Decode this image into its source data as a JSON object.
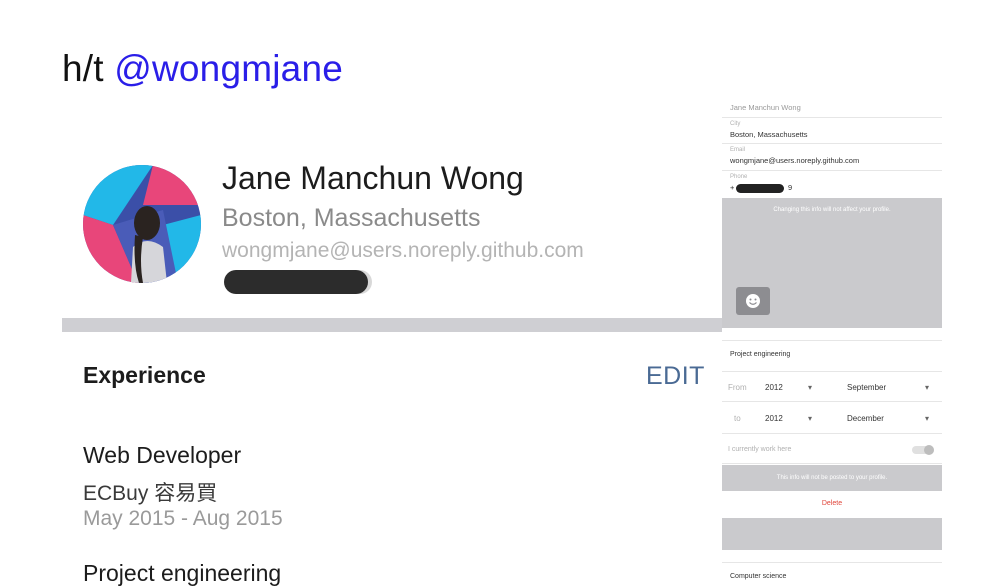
{
  "header": {
    "prefix": "h/t ",
    "handle": "@wongmjane"
  },
  "profile": {
    "name": "Jane Manchun Wong",
    "city": "Boston, Massachusetts",
    "email": "wongmjane@users.noreply.github.com"
  },
  "experience": {
    "title": "Experience",
    "edit_label": "EDIT",
    "jobs": [
      {
        "title": "Web Developer",
        "company": "ECBuy 容易買",
        "dates": "May 2015 - Aug 2015"
      },
      {
        "title": "Project engineering"
      }
    ]
  },
  "phone": {
    "top_partial": "Jane Manchun Wong",
    "city_label": "City",
    "city_value": "Boston, Massachusetts",
    "email_label": "Email",
    "email_value": "wongmjane@users.noreply.github.com",
    "phone_label": "Phone",
    "phone_prefix": "+",
    "phone_suffix": "9",
    "info_note": "Changing this info will not affect your profile.",
    "section_title": "Project engineering",
    "from_label": "From",
    "from_year": "2012",
    "from_month": "September",
    "to_label": "to",
    "to_year": "2012",
    "to_month": "December",
    "current_label": "I currently work here",
    "post_note": "This info will not be posted to your profile.",
    "delete_label": "Delete",
    "next_section": "Computer science"
  },
  "colors": {
    "handle": "#2a1ee8",
    "edit": "#4a6a94",
    "divider": "#cfcfd3",
    "delete": "#e0453a"
  }
}
